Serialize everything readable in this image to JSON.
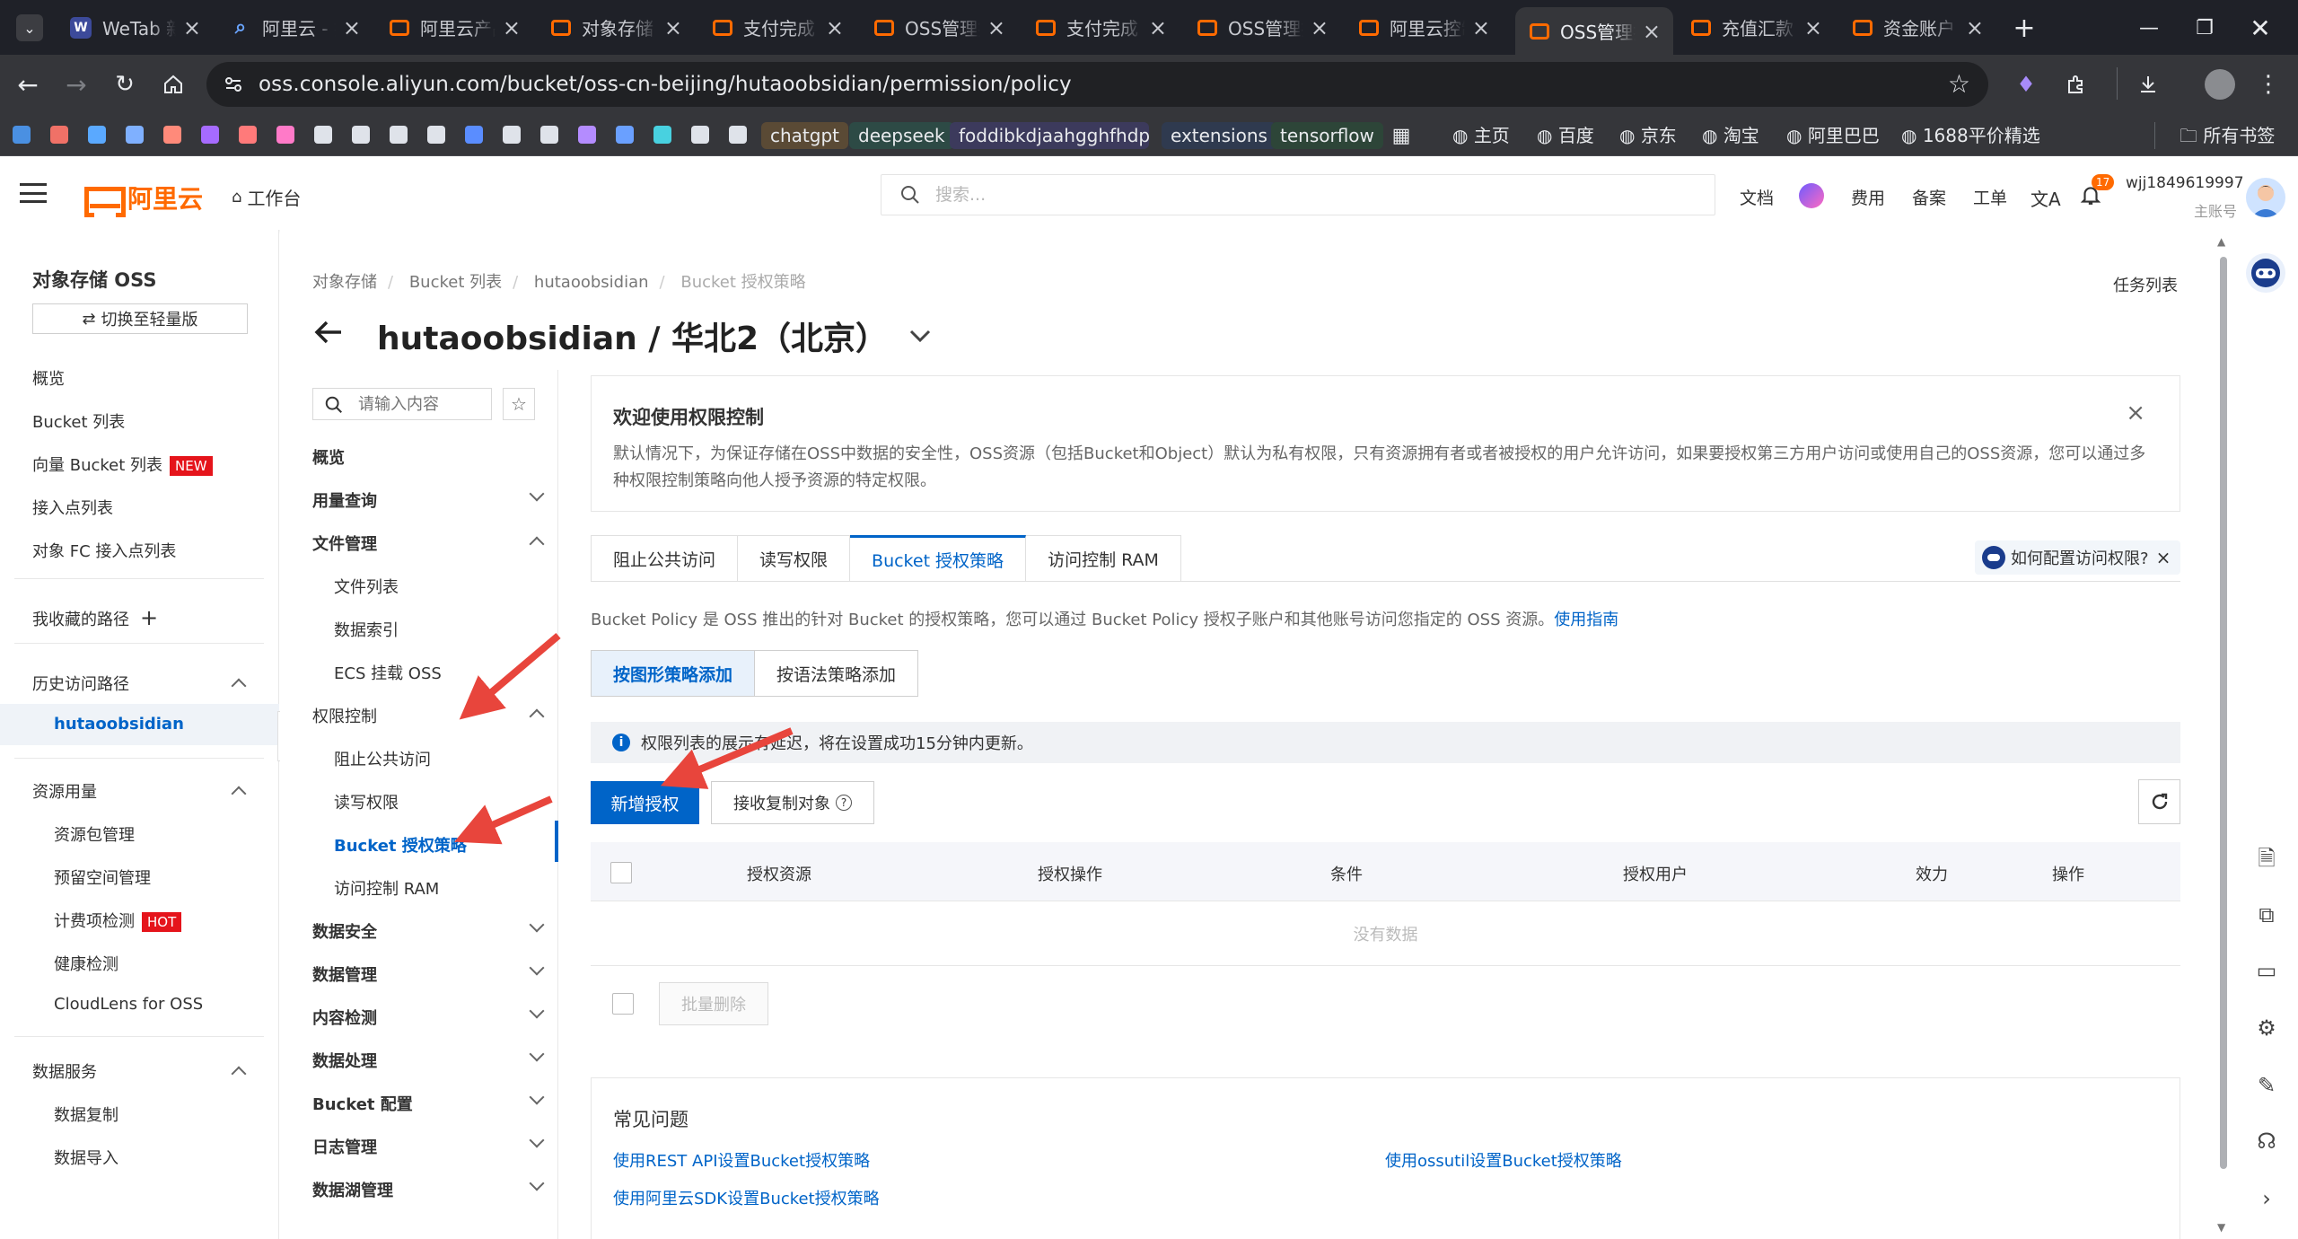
{
  "browser": {
    "tabs": [
      {
        "title": "WeTab 新标签页",
        "icon": "wetab-icon"
      },
      {
        "title": "阿里云 - 搜索",
        "icon": "search-icon"
      },
      {
        "title": "阿里云产品",
        "icon": "aliyun-icon"
      },
      {
        "title": "对象存储 OSS",
        "icon": "aliyun-icon"
      },
      {
        "title": "支付完成",
        "icon": "aliyun-icon"
      },
      {
        "title": "OSS管理控制台",
        "icon": "aliyun-icon"
      },
      {
        "title": "支付完成",
        "icon": "aliyun-icon"
      },
      {
        "title": "OSS管理控制台",
        "icon": "aliyun-icon"
      },
      {
        "title": "阿里云控制台",
        "icon": "aliyun-icon"
      },
      {
        "title": "OSS管理控制台",
        "icon": "aliyun-icon",
        "active": true
      },
      {
        "title": "充值汇款",
        "icon": "aliyun-icon"
      },
      {
        "title": "资金账户",
        "icon": "aliyun-icon"
      }
    ],
    "url": "oss.console.aliyun.com/bucket/oss-cn-beijing/hutaoobsidian/permission/policy",
    "bookmarks": {
      "chips": [
        "chatgpt",
        "deepseek",
        "foddibkdjaahgghfhdp...",
        "extensions",
        "tensorflow"
      ],
      "folders": [
        "主页",
        "百度",
        "京东",
        "淘宝",
        "阿里巴巴",
        "1688平价精选"
      ],
      "all_bookmarks": "所有书签"
    }
  },
  "header": {
    "logo_text": "阿里云",
    "workbench": "工作台",
    "search_placeholder": "搜索...",
    "links": [
      "文档",
      "费用",
      "备案",
      "工单"
    ],
    "notification_count": "17",
    "user_name": "wjj1849619997",
    "user_role": "主账号"
  },
  "sidebar": {
    "title": "对象存储 OSS",
    "switch_label": "切换至轻量版",
    "items": [
      "概览",
      "Bucket 列表",
      "向量 Bucket 列表",
      "接入点列表",
      "对象 FC 接入点列表"
    ],
    "new_tag": "NEW",
    "favorites": "我收藏的路径",
    "history": "历史访问路径",
    "history_item": "hutaoobsidian",
    "resources": "资源用量",
    "resource_items": [
      "资源包管理",
      "预留空间管理",
      "计费项检测",
      "健康检测",
      "CloudLens for OSS"
    ],
    "hot_tag": "HOT",
    "data_services": "数据服务",
    "data_service_items": [
      "数据复制",
      "数据导入"
    ]
  },
  "breadcrumb": [
    "对象存储",
    "Bucket 列表",
    "hutaoobsidian",
    "Bucket 授权策略"
  ],
  "task_list": "任务列表",
  "page_title": "hutaoobsidian / 华北2（北京）",
  "secnav": {
    "search_placeholder": "请输入内容",
    "overview": "概览",
    "usage": "用量查询",
    "file_mgmt": "文件管理",
    "file_subs": [
      "文件列表",
      "数据索引",
      "ECS 挂载 OSS"
    ],
    "perm": "权限控制",
    "perm_subs": [
      "阻止公共访问",
      "读写权限",
      "Bucket 授权策略",
      "访问控制 RAM"
    ],
    "groups": [
      "数据安全",
      "数据管理",
      "内容检测",
      "数据处理",
      "Bucket 配置",
      "日志管理",
      "数据湖管理"
    ]
  },
  "welcome": {
    "title": "欢迎使用权限控制",
    "text": "默认情况下，为保证存储在OSS中数据的安全性，OSS资源（包括Bucket和Object）默认为私有权限，只有资源拥有者或者被授权的用户允许访问，如果要授权第三方用户访问或使用自己的OSS资源，您可以通过多种权限控制策略向他人授予资源的特定权限。"
  },
  "tabs": [
    "阻止公共访问",
    "读写权限",
    "Bucket 授权策略",
    "访问控制 RAM"
  ],
  "help_chip": "如何配置访问权限?",
  "description": "Bucket Policy 是 OSS 推出的针对 Bucket 的授权策略，您可以通过 Bucket Policy 授权子账户和其他账号访问您指定的 OSS 资源。",
  "description_link": "使用指南",
  "mode_buttons": [
    "按图形策略添加",
    "按语法策略添加"
  ],
  "notice": "权限列表的展示有延迟，将在设置成功15分钟内更新。",
  "actions": {
    "add": "新增授权",
    "copy": "接收复制对象"
  },
  "table": {
    "columns": [
      "授权资源",
      "授权操作",
      "条件",
      "授权用户",
      "效力",
      "操作"
    ],
    "empty": "没有数据",
    "batch_delete": "批量删除"
  },
  "faq": {
    "title": "常见问题",
    "links": [
      "使用REST API设置Bucket授权策略",
      "使用ossutil设置Bucket授权策略",
      "使用阿里云SDK设置Bucket授权策略"
    ]
  },
  "colors": {
    "primary": "#0064c8",
    "brand": "#ff6a00",
    "annotation": "#e8453c"
  }
}
